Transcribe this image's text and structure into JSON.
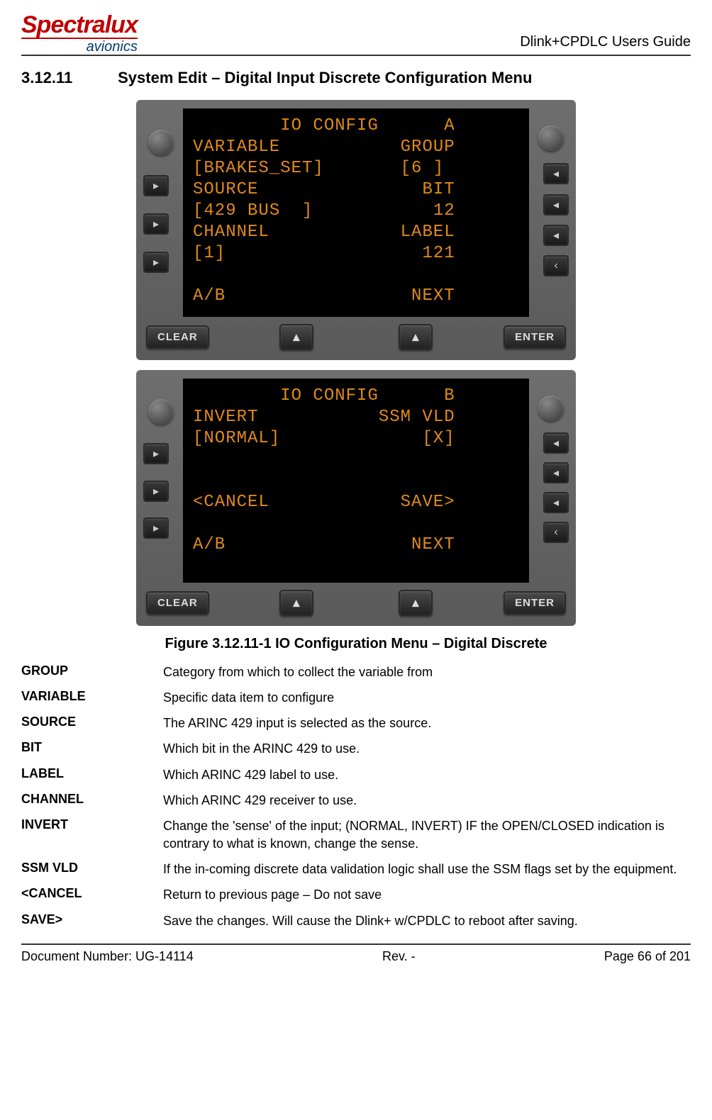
{
  "header": {
    "logo_main": "Spectralux",
    "logo_sub": "avionics",
    "doc_title": "Dlink+CPDLC Users Guide"
  },
  "section": {
    "number": "3.12.11",
    "title": "System Edit – Digital Input Discrete Configuration Menu"
  },
  "mcdu_buttons": {
    "clear": "CLEAR",
    "enter": "ENTER",
    "up": "▴",
    "left": "▸",
    "right": "◂",
    "back": "‹"
  },
  "screen_a": "        IO CONFIG      A\nVARIABLE           GROUP\n[BRAKES_SET]       [6 ]\nSOURCE               BIT\n[429 BUS  ]           12\nCHANNEL            LABEL\n[1]                  121\n\nA/B                 NEXT",
  "screen_b": "        IO CONFIG      B\nINVERT           SSM VLD\n[NORMAL]             [X]\n\n\n<CANCEL            SAVE>\n\nA/B                 NEXT",
  "figure_caption": "Figure 3.12.11-1 IO Configuration Menu –  Digital Discrete",
  "definitions": [
    {
      "term": "GROUP",
      "desc": "Category from which to collect the variable from"
    },
    {
      "term": "VARIABLE",
      "desc": "Specific data item to configure"
    },
    {
      "term": "SOURCE",
      "desc": "The ARINC 429 input is selected as the source."
    },
    {
      "term": "BIT",
      "desc": "Which bit in the ARINC 429 to use."
    },
    {
      "term": "LABEL",
      "desc": "Which ARINC 429 label to use."
    },
    {
      "term": "CHANNEL",
      "desc": "Which ARINC 429 receiver to use."
    },
    {
      "term": "INVERT",
      "desc": "Change the 'sense' of the input; (NORMAL, INVERT) IF the OPEN/CLOSED indication is contrary to what is known, change the sense."
    },
    {
      "term": "SSM VLD",
      "desc": "If the in-coming discrete data validation logic shall use the SSM flags set by the equipment."
    },
    {
      "term": "<CANCEL",
      "desc": "Return to previous page – Do not save"
    },
    {
      "term": "SAVE>",
      "desc": "Save the changes.  Will cause the Dlink+ w/CPDLC to reboot after saving."
    }
  ],
  "footer": {
    "doc_number": "Document Number:  UG-14114",
    "rev": "Rev. -",
    "page": "Page 66 of 201"
  }
}
